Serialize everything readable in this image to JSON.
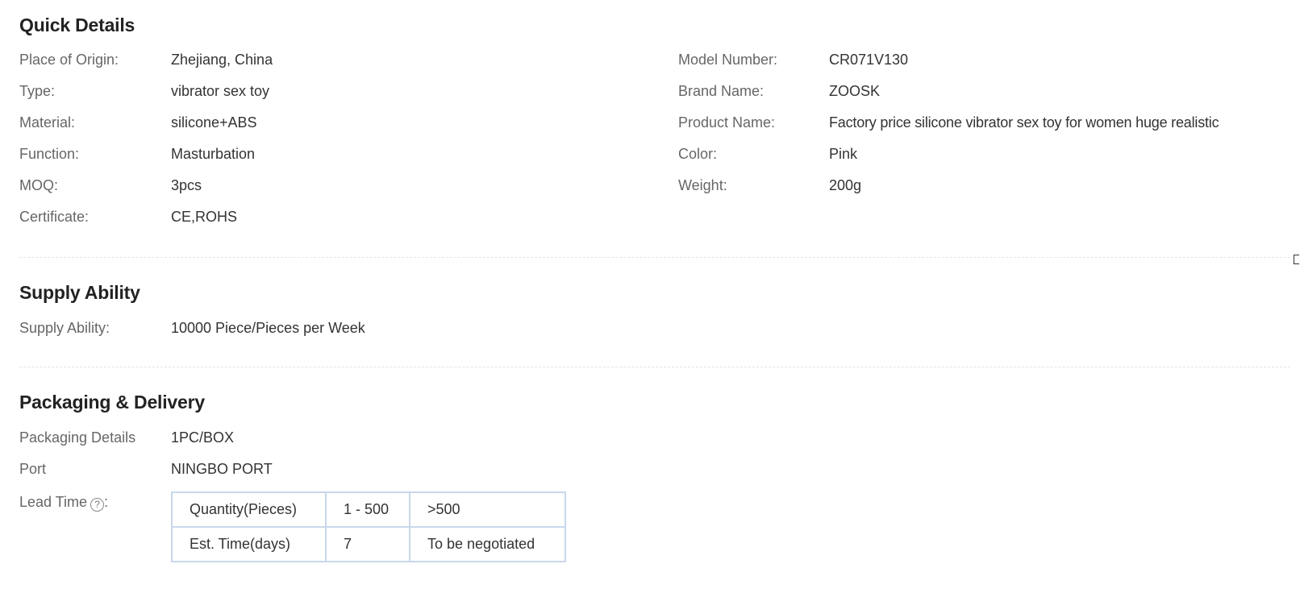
{
  "quick_details": {
    "title": "Quick Details",
    "left": [
      {
        "label": "Place of Origin:",
        "value": "Zhejiang, China"
      },
      {
        "label": "Type:",
        "value": "vibrator sex toy"
      },
      {
        "label": "Material:",
        "value": "silicone+ABS"
      },
      {
        "label": "Function:",
        "value": "Masturbation"
      },
      {
        "label": "MOQ:",
        "value": "3pcs"
      },
      {
        "label": "Certificate:",
        "value": "CE,ROHS"
      }
    ],
    "right": [
      {
        "label": "Model Number:",
        "value": "CR071V130"
      },
      {
        "label": "Brand Name:",
        "value": "ZOOSK"
      },
      {
        "label": "Product Name:",
        "value": "Factory price silicone vibrator sex toy for women huge realistic"
      },
      {
        "label": "Color:",
        "value": "Pink"
      },
      {
        "label": "Weight:",
        "value": "200g"
      }
    ]
  },
  "supply": {
    "title": "Supply Ability",
    "label": "Supply Ability:",
    "value": "10000 Piece/Pieces per Week"
  },
  "packaging": {
    "title": "Packaging & Delivery",
    "details_label": "Packaging Details",
    "details_value": "1PC/BOX",
    "port_label": "Port",
    "port_value": "NINGBO PORT",
    "lead_time_label": "Lead Time",
    "lead_time_suffix": ":",
    "help_icon": "question-circle-icon",
    "help_glyph": "?",
    "lead_table": {
      "rows": [
        [
          "Quantity(Pieces)",
          "1 - 500",
          ">500"
        ],
        [
          "Est. Time(days)",
          "7",
          "To be negotiated"
        ]
      ]
    }
  }
}
